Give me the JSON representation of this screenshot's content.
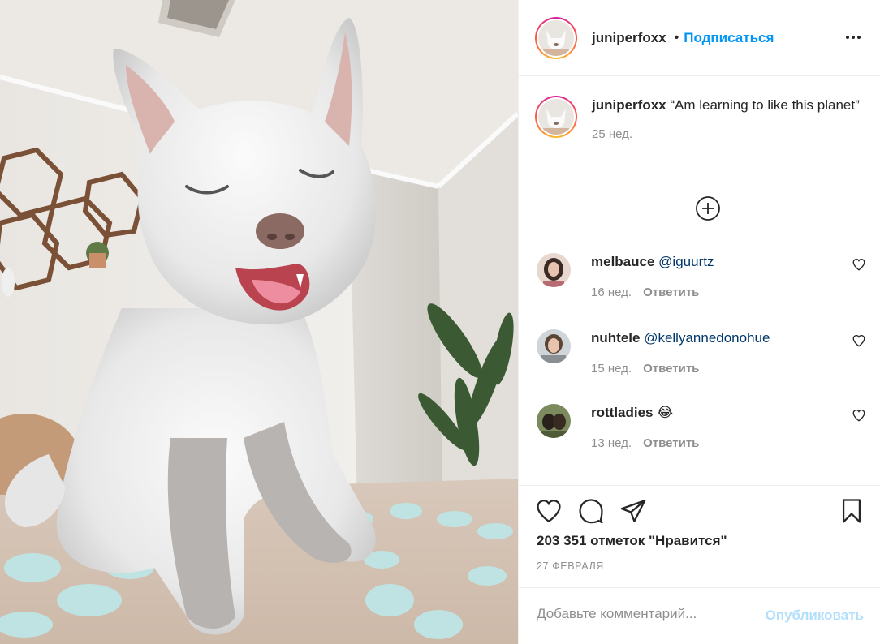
{
  "post": {
    "author": "juniperfoxx",
    "separator": "•",
    "follow_label": "Подписаться",
    "caption_text": "“Am learning to like this planet”",
    "caption_time": "25 нед.",
    "comments": [
      {
        "user": "melbauce",
        "text": "@iguurtz",
        "time": "16 нед.",
        "reply": "Ответить"
      },
      {
        "user": "nuhtele",
        "text": "@kellyannedonohue",
        "time": "15 нед.",
        "reply": "Ответить"
      },
      {
        "user": "rottladies",
        "text": "😂",
        "time": "13 нед.",
        "reply": "Ответить"
      }
    ],
    "likes": "203 351 отметок \"Нравится\"",
    "date": "27 ФЕВРАЛЯ",
    "comment_placeholder": "Добавьте комментарий...",
    "publish_label": "Опубликовать"
  },
  "colors": {
    "accent": "#0095f6",
    "publish_disabled": "#b2dffc",
    "meta_gray": "#8e8e8e",
    "divider": "#efefef"
  },
  "icons": [
    "more-options-icon",
    "load-more-icon",
    "heart-icon",
    "comment-icon",
    "share-icon",
    "bookmark-icon"
  ]
}
